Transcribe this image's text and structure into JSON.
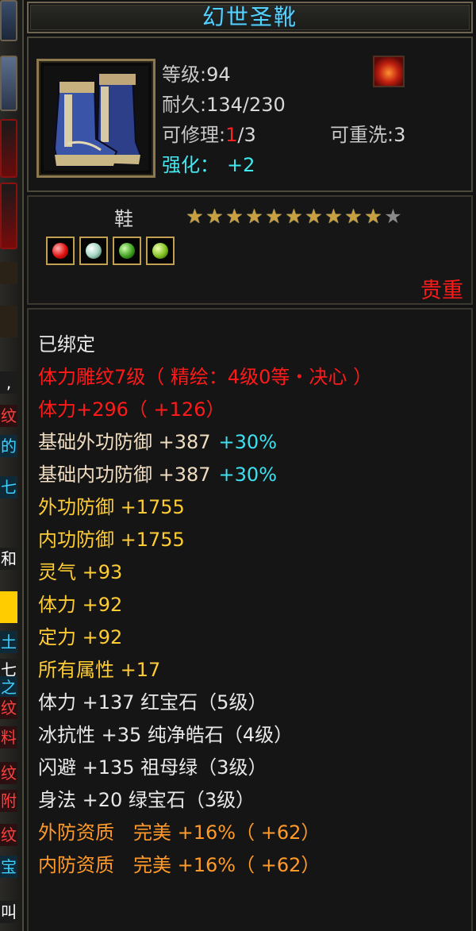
{
  "item": {
    "name": "幻世圣靴",
    "level_label": "等级",
    "level_value": "94",
    "durability_label": "耐久",
    "durability_value": "134/230",
    "repair_label": "可修理",
    "repair_used": "1",
    "repair_total": "/3",
    "rewash_label": "可重洗",
    "rewash_value": "3",
    "strength_label": "强化",
    "strength_value": "+2",
    "slot_type": "鞋",
    "stars_total": 11,
    "stars_filled": 10,
    "rarity": "贵重",
    "gems": [
      "red-gem-icon",
      "white-gem-icon",
      "green-gem-icon",
      "lime-gem-icon"
    ]
  },
  "attributes": [
    {
      "text": "已绑定",
      "color": "white"
    },
    {
      "text": "体力雕纹7级（ 精绘：4级0等・决心 ）",
      "color": "red"
    },
    {
      "text": "体力+296（ +126）",
      "color": "red"
    },
    {
      "text": "基础外功防御 +387",
      "extra": "+30%",
      "color": "cream"
    },
    {
      "text": "基础内功防御 +387",
      "extra": "+30%",
      "color": "cream"
    },
    {
      "text": "外功防御 +1755",
      "color": "yellow"
    },
    {
      "text": "内功防御 +1755",
      "color": "yellow"
    },
    {
      "text": "灵气 +93",
      "color": "yellow"
    },
    {
      "text": "体力 +92",
      "color": "yellow"
    },
    {
      "text": "定力 +92",
      "color": "yellow"
    },
    {
      "text": "所有属性 +17",
      "color": "yellow"
    },
    {
      "text": "体力 +137 红宝石（5级）",
      "color": "white"
    },
    {
      "text": "冰抗性 +35 纯净皓石（4级）",
      "color": "white"
    },
    {
      "text": "闪避 +135 祖母绿（3级）",
      "color": "white"
    },
    {
      "text": "身法 +20 绿宝石（3级）",
      "color": "white"
    },
    {
      "text": "外防资质　完美 +16%（ +62）",
      "color": "orange"
    },
    {
      "text": "内防资质　完美 +16%（ +62）",
      "color": "orange"
    }
  ],
  "left_strip": {
    "chips": [
      ",",
      "纹",
      "的",
      "七",
      "和",
      "土",
      "七",
      "之",
      "纹",
      "料",
      "纹",
      "附",
      "纹",
      "宝",
      "叫"
    ]
  }
}
